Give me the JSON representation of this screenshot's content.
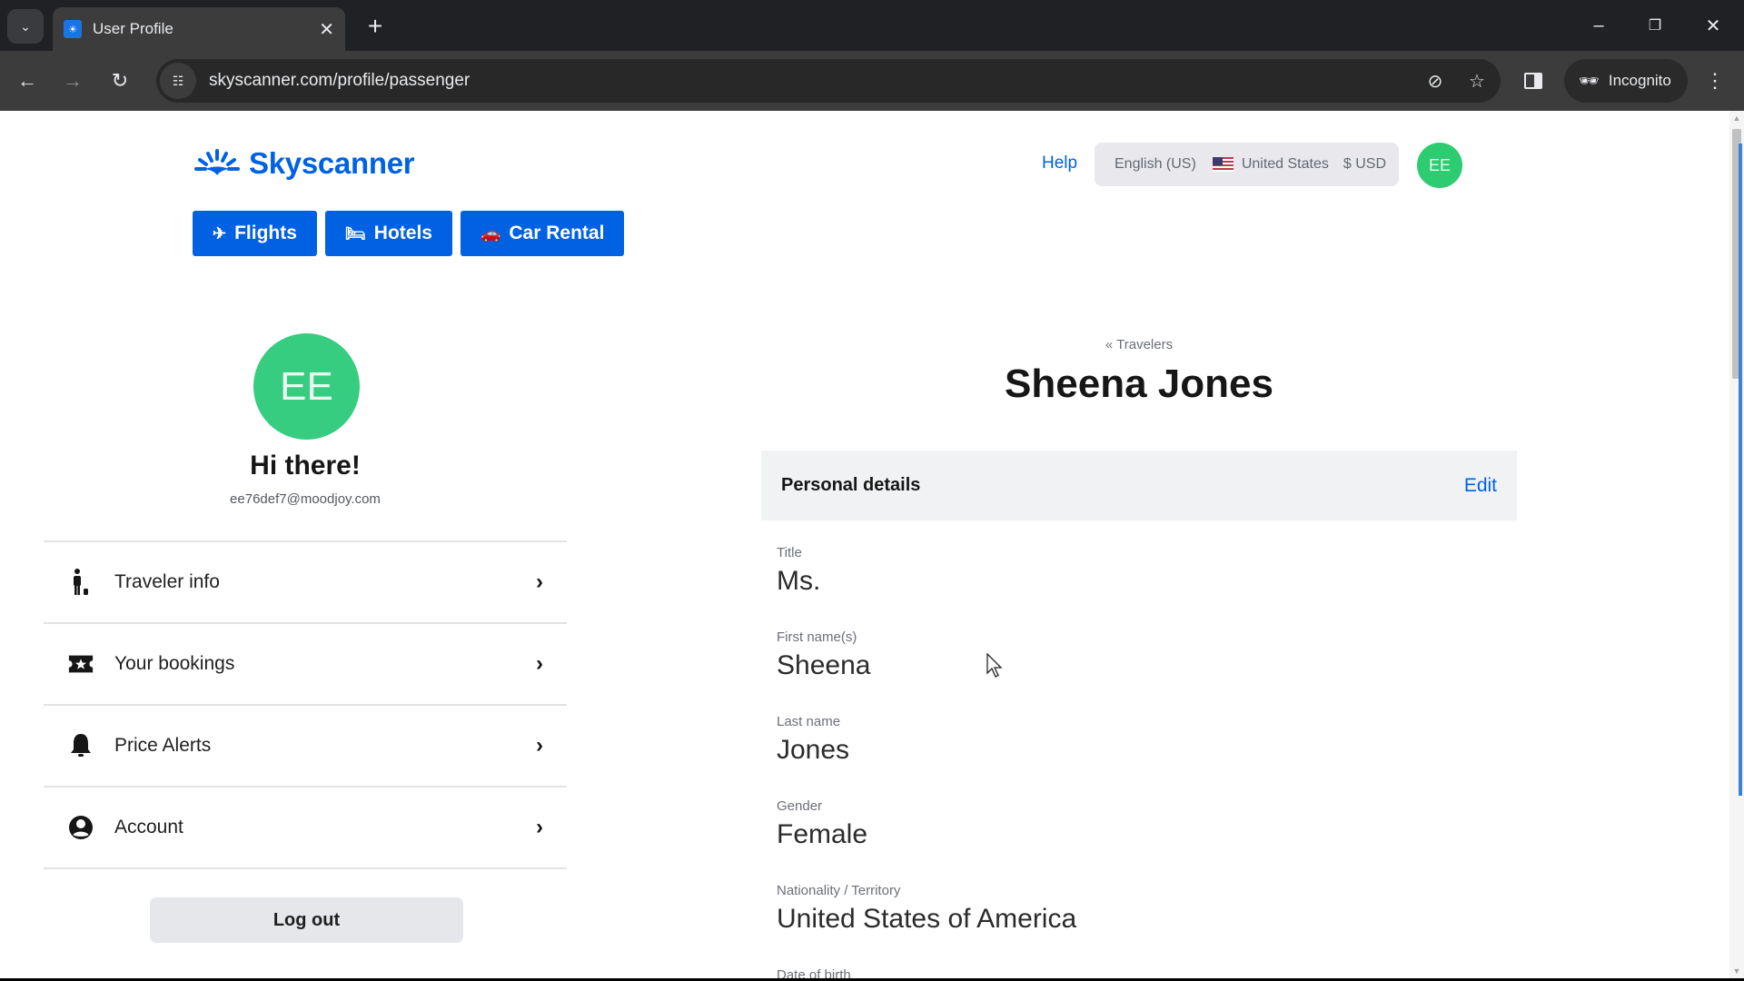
{
  "browser": {
    "tab": {
      "title": "User Profile",
      "favicon": "skyscanner-favicon"
    },
    "new_tab_symbol": "+",
    "url": "skyscanner.com/profile/passenger",
    "incognito_label": "Incognito",
    "window_controls": {
      "minimize": "–",
      "restore": "❐",
      "close": "✕"
    }
  },
  "header": {
    "brand": "Skyscanner",
    "help_label": "Help",
    "locale": {
      "language": "English (US)",
      "country": "United States",
      "currency": "$ USD"
    },
    "avatar_initials": "EE",
    "colors": {
      "brand_blue": "#0062e3",
      "avatar_green": "#2ecc71"
    }
  },
  "vertical_nav": [
    {
      "label": "Flights",
      "icon": "plane-icon"
    },
    {
      "label": "Hotels",
      "icon": "bed-icon"
    },
    {
      "label": "Car Rental",
      "icon": "car-icon"
    }
  ],
  "profile": {
    "avatar_initials": "EE",
    "greeting": "Hi there!",
    "email": "ee76def7@moodjoy.com"
  },
  "side_menu": [
    {
      "label": "Traveler info",
      "icon": "traveler-icon"
    },
    {
      "label": "Your bookings",
      "icon": "ticket-icon"
    },
    {
      "label": "Price Alerts",
      "icon": "bell-icon"
    },
    {
      "label": "Account",
      "icon": "account-icon"
    }
  ],
  "logout_label": "Log out",
  "traveler": {
    "breadcrumb": "« Travelers",
    "name": "Sheena Jones",
    "section_title": "Personal details",
    "edit_label": "Edit",
    "fields": [
      {
        "label": "Title",
        "value": "Ms."
      },
      {
        "label": "First name(s)",
        "value": "Sheena"
      },
      {
        "label": "Last name",
        "value": "Jones"
      },
      {
        "label": "Gender",
        "value": "Female"
      },
      {
        "label": "Nationality / Territory",
        "value": "United States of America"
      },
      {
        "label": "Date of birth",
        "value": ""
      }
    ]
  }
}
